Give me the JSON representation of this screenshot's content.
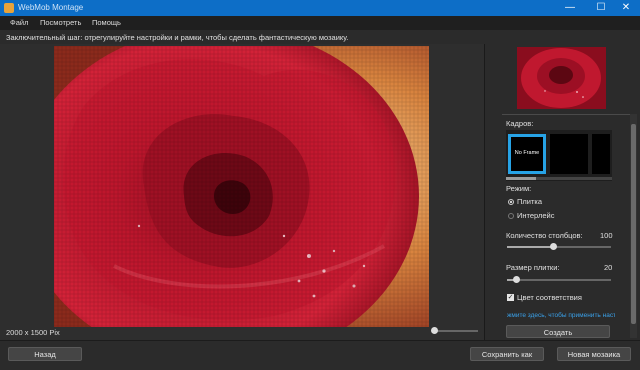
{
  "window": {
    "title": "WebMob Montage",
    "buttons": {
      "minimize": "—",
      "maximize": "☐",
      "close": "✕"
    }
  },
  "menu": {
    "items": [
      "Файл",
      "Посмотреть",
      "Помощь"
    ]
  },
  "instruction": "Заключительный шаг: отрегулируйте настройки и рамки, чтобы сделать фантастическую мозаику.",
  "canvas": {
    "dimensions": "2000 x 1500 Pix"
  },
  "settings": {
    "frames_label": "Кадров:",
    "frame_selected_label": "No Frame",
    "mode_label": "Режим:",
    "mode_options": [
      "Плитка",
      "Интерлейс"
    ],
    "mode_selected": "Плитка",
    "columns_label": "Количество столбцов:",
    "columns_value": "100",
    "columns_fraction": 0.35,
    "tile_size_label": "Размер плитки:",
    "tile_size_value": "20",
    "tile_size_fraction": 0.08,
    "color_match_label": "Цвет соответствия",
    "color_match_checked": true,
    "apply_link": "жмите здесь, чтобы применить настрой",
    "create_button": "Создать"
  },
  "footer": {
    "back_button": "Назад",
    "save_as_button": "Сохранить как",
    "new_mosaic_button": "Новая мозаика"
  },
  "colors": {
    "accent": "#27a3e6",
    "titlebar": "#0d6ec7",
    "link": "#3aa0e8"
  },
  "icons": {
    "app": "mosaic-app-icon",
    "radio_selected": "radio-on",
    "check": "checkmark"
  }
}
